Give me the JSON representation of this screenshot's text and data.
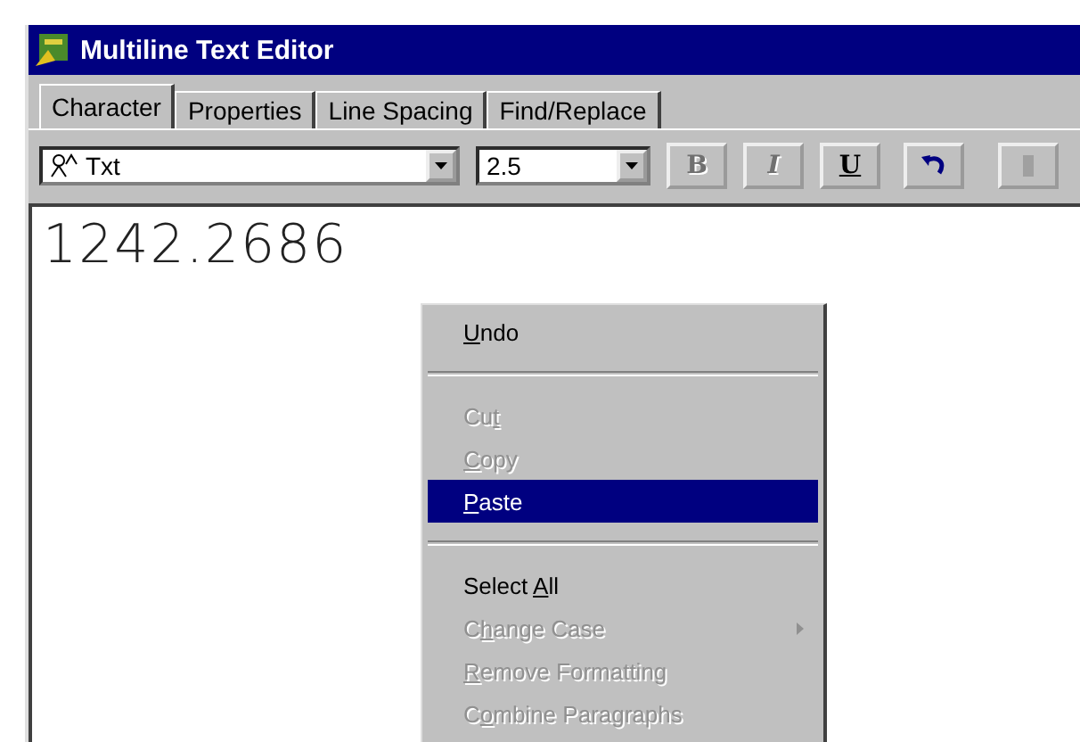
{
  "window": {
    "title": "Multiline Text Editor"
  },
  "tabs": [
    {
      "label": "Character",
      "selected": true
    },
    {
      "label": "Properties",
      "selected": false
    },
    {
      "label": "Line Spacing",
      "selected": false
    },
    {
      "label": "Find/Replace",
      "selected": false
    }
  ],
  "toolbar": {
    "font": "Txt",
    "size": "2.5",
    "buttons": [
      {
        "label": "B",
        "kind": "bold",
        "disabled": true
      },
      {
        "label": "I",
        "kind": "italic",
        "disabled": true
      },
      {
        "label": "U",
        "kind": "underline",
        "disabled": false
      },
      {
        "kind": "undo"
      },
      {
        "kind": "more",
        "disabled": true
      }
    ]
  },
  "editor": {
    "value": "1242.2686"
  },
  "context_menu": {
    "items": [
      {
        "kind": "item",
        "access_key": "U",
        "after": "ndo",
        "disabled": false,
        "selected": false
      },
      {
        "kind": "separator"
      },
      {
        "kind": "item",
        "before": "Cu",
        "access_key": "t",
        "disabled": true,
        "selected": false
      },
      {
        "kind": "item",
        "access_key": "C",
        "after": "opy",
        "disabled": true,
        "selected": false
      },
      {
        "kind": "item",
        "access_key": "P",
        "after": "aste",
        "disabled": false,
        "selected": true
      },
      {
        "kind": "separator"
      },
      {
        "kind": "item",
        "before": "Select ",
        "access_key": "A",
        "after": "ll",
        "disabled": false,
        "selected": false
      },
      {
        "kind": "submenu",
        "before": "C",
        "access_key": "h",
        "after": "ange Case",
        "disabled": true,
        "selected": false
      },
      {
        "kind": "item",
        "access_key": "R",
        "after": "emove Formatting",
        "disabled": true,
        "selected": false
      },
      {
        "kind": "item",
        "before": "C",
        "access_key": "o",
        "after": "mbine Paragraphs",
        "disabled": true,
        "selected": false
      }
    ]
  }
}
